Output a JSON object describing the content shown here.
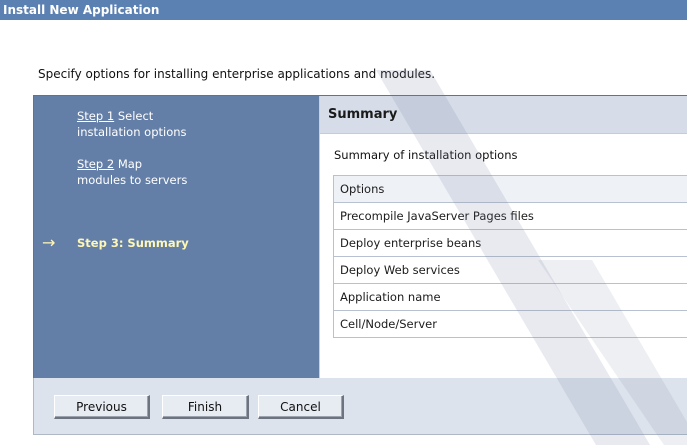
{
  "window": {
    "title": "Install New Application"
  },
  "instruction": "Specify options for installing enterprise applications and modules.",
  "wizard": {
    "steps": [
      {
        "label": "Step 1",
        "description": "Select",
        "description_line2": "installation options"
      },
      {
        "label": "Step 2",
        "description": "Map",
        "description_line2": "modules to servers"
      },
      {
        "label": "Step 3: Summary"
      }
    ],
    "current_step_arrow": "→"
  },
  "summary": {
    "heading": "Summary",
    "subheading": "Summary of installation options",
    "table_header": "Options",
    "rows": [
      "Precompile JavaServer Pages files",
      "Deploy enterprise beans",
      "Deploy Web services",
      "Application name",
      "Cell/Node/Server"
    ]
  },
  "buttons": {
    "previous": "Previous",
    "finish": "Finish",
    "cancel": "Cancel"
  },
  "colors": {
    "title_bar": "#5b80b2",
    "sidebar": "#647fa7",
    "current_step_text": "#fff7b5",
    "summary_header": "#d6dde9",
    "button_bar": "#dde3ec"
  },
  "icons": {
    "current_step": "arrow-right-icon"
  }
}
